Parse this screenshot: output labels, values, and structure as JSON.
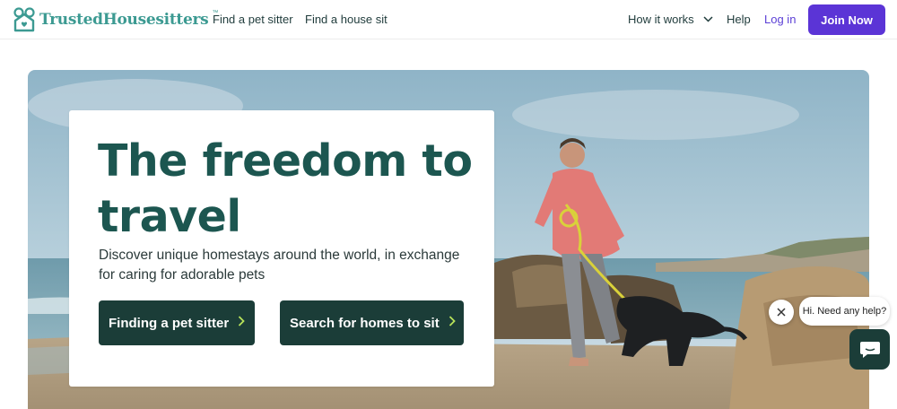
{
  "nav": {
    "logo_text": "TrustedHousesitters",
    "logo_tm": "™",
    "find_sitter": "Find a pet sitter",
    "find_sit": "Find a house sit",
    "how_it_works": "How it works",
    "help": "Help",
    "login": "Log in",
    "join": "Join Now"
  },
  "hero": {
    "headline": "The freedom to travel",
    "subtext": "Discover unique homestays around the world, in exchange for caring for adorable pets",
    "cta_sitter": "Finding a pet sitter",
    "cta_homes": "Search for homes to sit"
  },
  "chat": {
    "greeting": "Hi. Need any help?"
  },
  "colors": {
    "brand_teal": "#3c9a92",
    "join_purple": "#5b34d6",
    "cta_dark": "#1b3d38",
    "headline": "#1c5650"
  },
  "icons": [
    "logo-house-icon",
    "chevron-down-icon",
    "chevron-right-icon",
    "close-icon",
    "chat-icon"
  ]
}
